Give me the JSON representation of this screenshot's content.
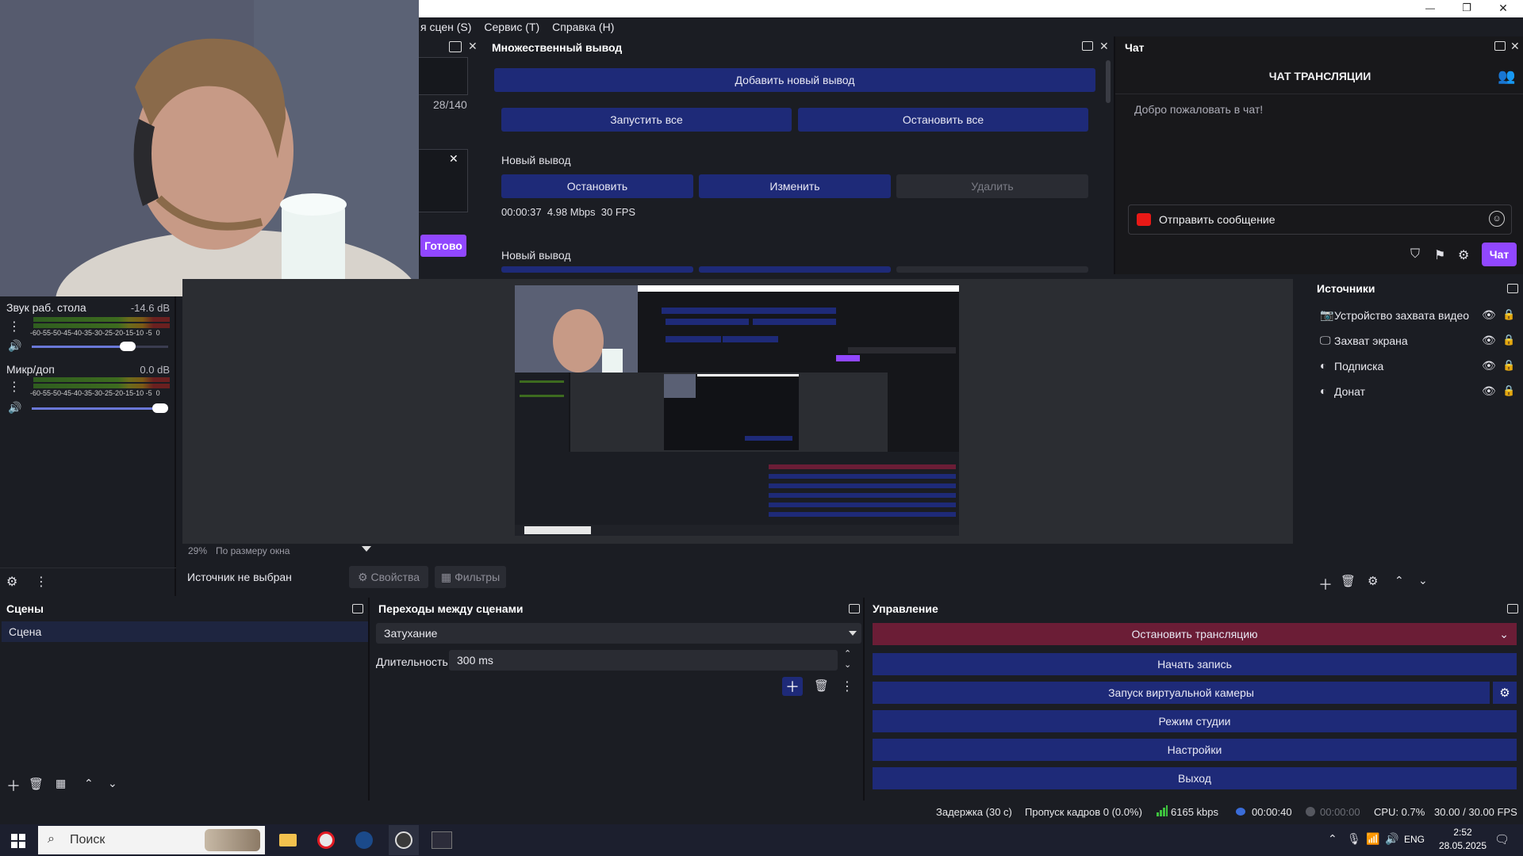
{
  "window": {
    "minimize": "—",
    "restore": "❐",
    "close": "✕"
  },
  "menu": {
    "items": [
      "я сцен (S)",
      "Сервис (T)",
      "Справка (H)"
    ]
  },
  "left_panel": {
    "counter": "28/140",
    "done_button": "Готово"
  },
  "multi_output": {
    "title": "Множественный вывод",
    "add_button": "Добавить новый вывод",
    "start_all": "Запустить все",
    "stop_all": "Остановить все",
    "output1": {
      "label": "Новый вывод",
      "stop": "Остановить",
      "edit": "Изменить",
      "delete": "Удалить",
      "stats": "00:00:37  4.98 Mbps  30 FPS"
    },
    "output2": {
      "label": "Новый вывод"
    }
  },
  "chat": {
    "dock_title": "Чат",
    "header": "ЧАТ ТРАНСЛЯЦИИ",
    "welcome": "Добро пожаловать в чат!",
    "input_placeholder": "Отправить сообщение",
    "chat_button": "Чат",
    "accent": "#9147ff"
  },
  "audio_mixer": {
    "channels": [
      {
        "name": "Звук раб. стола",
        "level": "-14.6 dB",
        "scale": "-60-55-50-45-40-35-30-25-20-15-10 -5  0",
        "volume": 0.73
      },
      {
        "name": "Микр/доп",
        "level": "0.0 dB",
        "scale": "-60-55-50-45-40-35-30-25-20-15-10 -5  0",
        "volume": 1.0
      }
    ]
  },
  "preview": {
    "zoom": "29%",
    "scale_mode": "По размеру окна"
  },
  "source_toolbar": {
    "status": "Источник не выбран",
    "properties": "Свойства",
    "filters": "Фильтры"
  },
  "sources": {
    "title": "Источники",
    "items": [
      {
        "name": "Устройство захвата видео",
        "icon": "camera-icon"
      },
      {
        "name": "Захват экрана",
        "icon": "monitor-icon"
      },
      {
        "name": "Подписка",
        "icon": "browser-icon"
      },
      {
        "name": "Донат",
        "icon": "browser-icon"
      }
    ]
  },
  "scenes": {
    "title": "Сцены",
    "items": [
      "Сцена"
    ]
  },
  "transitions": {
    "title": "Переходы между сценами",
    "selected": "Затухание",
    "duration_label": "Длительность",
    "duration_value": "300 ms"
  },
  "controls": {
    "title": "Управление",
    "stop_stream": "Остановить трансляцию",
    "start_record": "Начать запись",
    "virtual_cam": "Запуск виртуальной камеры",
    "studio_mode": "Режим студии",
    "settings": "Настройки",
    "exit": "Выход",
    "stop_color": "#6b1d36",
    "button_color": "#1e2a78"
  },
  "status_bar": {
    "delay": "Задержка (30 с)",
    "dropped": "Пропуск кадров 0 (0.0%)",
    "bitrate": "6165 kbps",
    "stream_time": "00:00:40",
    "record_time": "00:00:00",
    "cpu": "CPU: 0.7%",
    "fps": "30.00 / 30.00 FPS"
  },
  "taskbar": {
    "search_placeholder": "Поиск",
    "lang": "ENG",
    "time": "2:52",
    "date": "28.05.2025"
  }
}
